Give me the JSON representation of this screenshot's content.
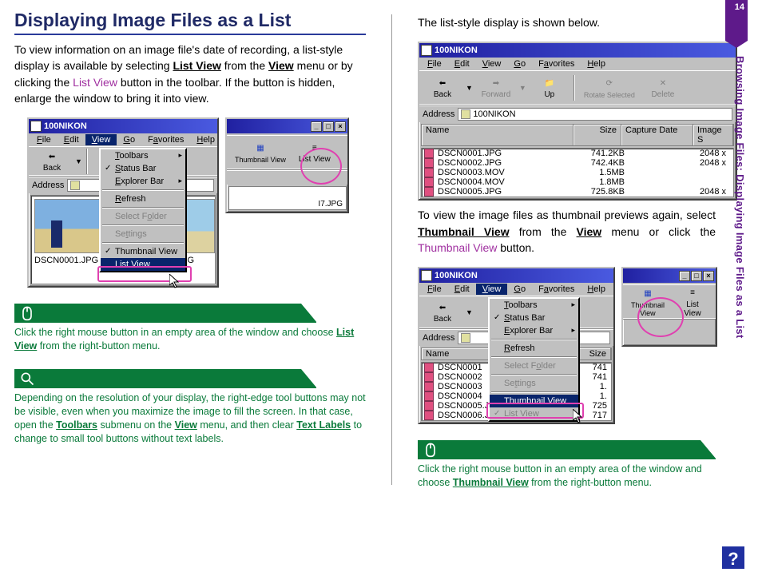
{
  "page_number": "14",
  "side_title": "Browsing Image Files: Displaying Image Files as a List",
  "heading": "Displaying Image Files as a List",
  "intro_parts": {
    "a": "To view information on an image file's date of recording, a list-style display is available by selecting ",
    "b": "List View",
    "c": " from the ",
    "d": "View",
    "e": " menu or by clicking the ",
    "f": "List View",
    "g": " button in the toolbar.  If the button is hidden, enlarge the window to bring it into view."
  },
  "win_title": "100NIKON",
  "winctl": {
    "min": "_",
    "max": "□",
    "close": "×"
  },
  "menus": {
    "file": "File",
    "edit": "Edit",
    "view": "View",
    "go": "Go",
    "favorites": "Favorites",
    "help": "Help"
  },
  "address_label": "Address",
  "address_value": "100NIKON",
  "nav": {
    "back": "Back",
    "forward": "Forward",
    "up": "Up",
    "rotate": "Rotate Selected",
    "delete": "Delete"
  },
  "view_menu": {
    "toolbars": "Toolbars",
    "status_bar": "Status Bar",
    "explorer_bar": "Explorer Bar",
    "refresh": "Refresh",
    "select_folder": "Select Folder",
    "settings": "Settings",
    "thumbnail_view": "Thumbnail View",
    "list_view": "List View"
  },
  "thumbs": [
    "DSCN0001.JPG",
    "DSCN0002.JPG",
    "I7.JPG"
  ],
  "toolbar_small": {
    "thumbnail": "Thumbnail View",
    "listview": "List View"
  },
  "tip1": {
    "a": "Click the right mouse button in an empty area of the window and choose ",
    "b": "List View",
    "c": " from the right-button menu."
  },
  "tip2": {
    "a": "Depending on the resolution of your display, the right-edge tool buttons may not be visible, even when you maximize the image to fill the screen.  In that case, open the ",
    "b": "Toolbars",
    "c": " submenu on the ",
    "d": "View",
    "e": " menu, and then clear ",
    "f": "Text Labels",
    "g": " to change to small tool buttons without text labels."
  },
  "right_intro": "The list-style display is shown below.",
  "list_headers": {
    "name": "Name",
    "size": "Size",
    "capture": "Capture Date",
    "imgsize": "Image S"
  },
  "list_rows": [
    {
      "name": "DSCN0001.JPG",
      "size": "741.2KB",
      "capture": "",
      "img": "2048 x"
    },
    {
      "name": "DSCN0002.JPG",
      "size": "742.4KB",
      "capture": "",
      "img": "2048 x"
    },
    {
      "name": "DSCN0003.MOV",
      "size": "1.5MB",
      "capture": "",
      "img": ""
    },
    {
      "name": "DSCN0004.MOV",
      "size": "1.8MB",
      "capture": "",
      "img": ""
    },
    {
      "name": "DSCN0005.JPG",
      "size": "725.8KB",
      "capture": "",
      "img": "2048 x"
    }
  ],
  "right_para2": {
    "a": "To view the image files as thumbnail previews again, select ",
    "b": "Thumbnail View",
    "c": " from the ",
    "d": "View",
    "e": " menu or click the ",
    "f": "Thumbnail View",
    "g": " button."
  },
  "list_b": [
    {
      "name": "DSCN0001",
      "size": "741"
    },
    {
      "name": "DSCN0002",
      "size": "741"
    },
    {
      "name": "DSCN0003",
      "size": "1."
    },
    {
      "name": "DSCN0004",
      "size": "1."
    },
    {
      "name": "DSCN0005.JPG",
      "size": "725"
    },
    {
      "name": "DSCN0006.JPG",
      "size": "717"
    }
  ],
  "tip3": {
    "a": "Click the right mouse button in an empty area of the window and choose ",
    "b": "Thumbnail View",
    "c": " from the right-button menu."
  },
  "help_badge": "?"
}
